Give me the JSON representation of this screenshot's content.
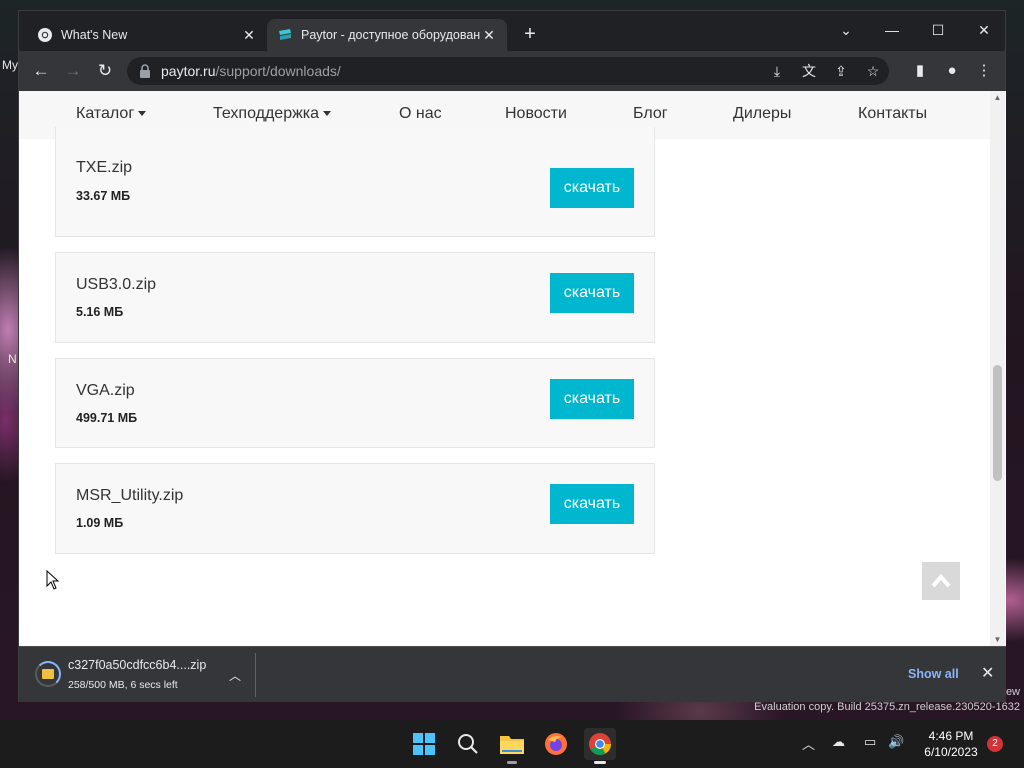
{
  "browser": {
    "tabs": [
      {
        "title": "What's New",
        "active": false
      },
      {
        "title": "Paytor - доступное оборудован",
        "active": true
      }
    ],
    "new_tab_label": "+",
    "window_controls": {
      "dropdown": "⌄",
      "minimize": "—",
      "maximize": "☐",
      "close": "✕"
    },
    "url_host": "paytor.ru",
    "url_path": "/support/downloads/",
    "nav": {
      "back": "←",
      "forward": "→",
      "reload": "↻"
    }
  },
  "site_nav": {
    "items": [
      {
        "label": "Каталог",
        "dropdown": true
      },
      {
        "label": "Техподдержка",
        "dropdown": true
      },
      {
        "label": "О нас",
        "dropdown": false
      },
      {
        "label": "Новости",
        "dropdown": false
      },
      {
        "label": "Блог",
        "dropdown": false
      },
      {
        "label": "Дилеры",
        "dropdown": false
      },
      {
        "label": "Контакты",
        "dropdown": false
      }
    ]
  },
  "downloads": {
    "button_label": "скачать",
    "files": [
      {
        "name": "TXE.zip",
        "size": "33.67 МБ"
      },
      {
        "name": "USB3.0.zip",
        "size": "5.16 МБ"
      },
      {
        "name": "VGA.zip",
        "size": "499.71 МБ"
      },
      {
        "name": "MSR_Utility.zip",
        "size": "1.09 МБ"
      }
    ]
  },
  "download_shelf": {
    "file_name": "c327f0a50cdfcc6b4....zip",
    "status": "258/500 MB, 6 secs left",
    "progress_fraction": 0.516,
    "show_all_label": "Show all",
    "close_label": "✕"
  },
  "desktop": {
    "label_my": "My",
    "label_n": "N",
    "watermark": "Evaluation copy. Build 25375.zn_release.230520-1632",
    "watermark_tail": "ew"
  },
  "taskbar": {
    "clock_time": "4:46 PM",
    "clock_date": "6/10/2023",
    "notification_count": "2"
  },
  "colors": {
    "accent": "#00b7cf",
    "link_blue": "#8ab4f8",
    "browser_dark": "#202124"
  }
}
